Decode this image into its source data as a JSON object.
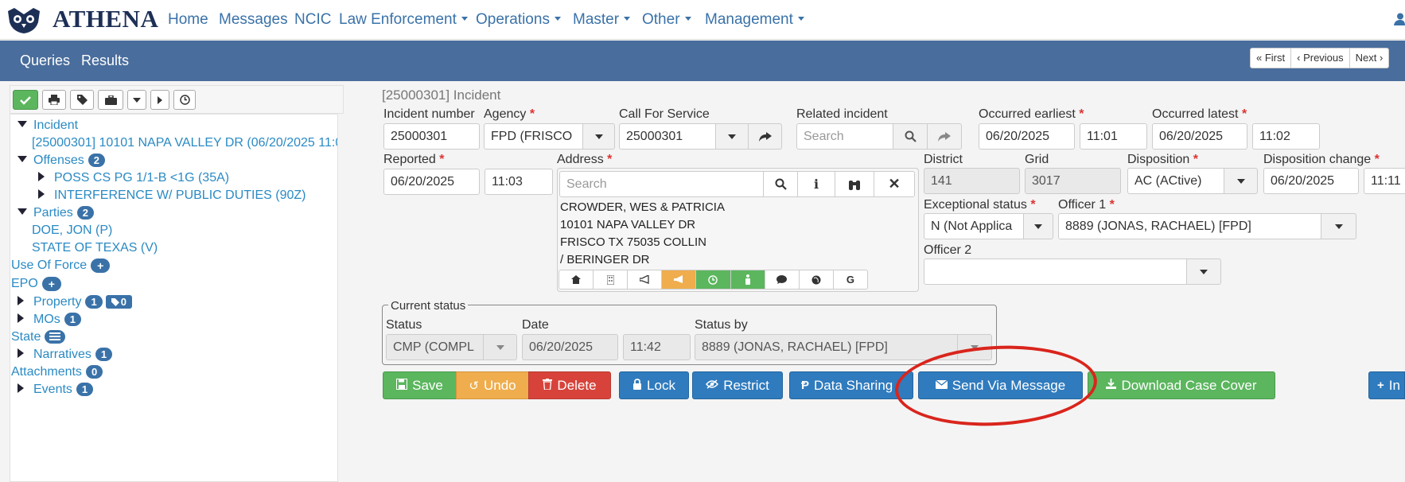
{
  "brand": {
    "name": "ATHENA"
  },
  "nav": {
    "items": [
      {
        "label": "Home",
        "dropdown": false
      },
      {
        "label": "Messages",
        "dropdown": false
      },
      {
        "label": "NCIC",
        "dropdown": false
      },
      {
        "label": "Law Enforcement",
        "dropdown": true
      },
      {
        "label": "Operations",
        "dropdown": true
      },
      {
        "label": "Master",
        "dropdown": true
      },
      {
        "label": "Other",
        "dropdown": true
      },
      {
        "label": "Management",
        "dropdown": true
      }
    ]
  },
  "subnav": {
    "queries": "Queries",
    "results": "Results",
    "pager": {
      "first": "« First",
      "previous": "‹ Previous",
      "next": "Next ›"
    }
  },
  "tree": {
    "incident": {
      "label": "Incident",
      "item": "[25000301] 10101 NAPA VALLEY DR (06/20/2025 11:0"
    },
    "offenses": {
      "label": "Offenses",
      "count": "2",
      "items": [
        "POSS CS PG 1/1-B <1G (35A)",
        "INTERFERENCE W/ PUBLIC DUTIES (90Z)"
      ]
    },
    "parties": {
      "label": "Parties",
      "count": "2",
      "items": [
        "DOE, JON (P)",
        "STATE OF TEXAS (V)"
      ]
    },
    "use_of_force": {
      "label": "Use Of Force"
    },
    "epo": {
      "label": "EPO"
    },
    "property": {
      "label": "Property",
      "count": "1",
      "tag_count": "0"
    },
    "mos": {
      "label": "MOs",
      "count": "1"
    },
    "state": {
      "label": "State"
    },
    "narratives": {
      "label": "Narratives",
      "count": "1"
    },
    "attachments": {
      "label": "Attachments",
      "count": "0"
    },
    "events": {
      "label": "Events",
      "count": "1"
    }
  },
  "form": {
    "title": "[25000301] Incident",
    "incident_number": {
      "label": "Incident number",
      "value": "25000301"
    },
    "agency": {
      "label": "Agency",
      "value": "FPD (FRISCO"
    },
    "call_for_service": {
      "label": "Call For Service",
      "value": "25000301"
    },
    "related_incident": {
      "label": "Related incident",
      "placeholder": "Search"
    },
    "occurred_earliest": {
      "label": "Occurred earliest",
      "date": "06/20/2025",
      "time": "11:01"
    },
    "occurred_latest": {
      "label": "Occurred latest",
      "date": "06/20/2025",
      "time": "11:02"
    },
    "reported": {
      "label": "Reported",
      "date": "06/20/2025",
      "time": "11:03"
    },
    "address": {
      "label": "Address",
      "placeholder": "Search",
      "lines": [
        "CROWDER, WES & PATRICIA",
        "10101 NAPA VALLEY DR",
        "FRISCO TX 75035 COLLIN",
        "/ BERINGER DR"
      ]
    },
    "district": {
      "label": "District",
      "value": "141"
    },
    "grid": {
      "label": "Grid",
      "value": "3017"
    },
    "disposition": {
      "label": "Disposition",
      "value": "AC (ACtive)"
    },
    "disposition_change": {
      "label": "Disposition change",
      "date": "06/20/2025",
      "time": "11:11"
    },
    "exceptional_status": {
      "label": "Exceptional status",
      "value": "N (Not Applica"
    },
    "officer1": {
      "label": "Officer 1",
      "value": "8889 (JONAS, RACHAEL) [FPD]"
    },
    "officer2": {
      "label": "Officer 2",
      "value": ""
    },
    "current_status": {
      "legend": "Current status",
      "status_label": "Status",
      "status": "CMP (COMPL",
      "date_label": "Date",
      "date": "06/20/2025",
      "time": "11:42",
      "by_label": "Status by",
      "by": "8889 (JONAS, RACHAEL) [FPD]"
    }
  },
  "buttons": {
    "save": "Save",
    "undo": "Undo",
    "delete": "Delete",
    "lock": "Lock",
    "restrict": "Restrict",
    "data_sharing": "Data Sharing",
    "send_via_message": "Send Via Message",
    "download_case_cover": "Download Case Cover",
    "more": "In"
  },
  "colors": {
    "brand": "#1d2f55",
    "nav_link": "#3a72a8",
    "subnav_bg": "#496d9c",
    "tree_link": "#2a8ac4",
    "button_green": "#5bb65e",
    "button_orange": "#efad4d",
    "button_red": "#d7433a",
    "button_blue": "#2f7bbe",
    "annotation_red": "#d9251c"
  }
}
